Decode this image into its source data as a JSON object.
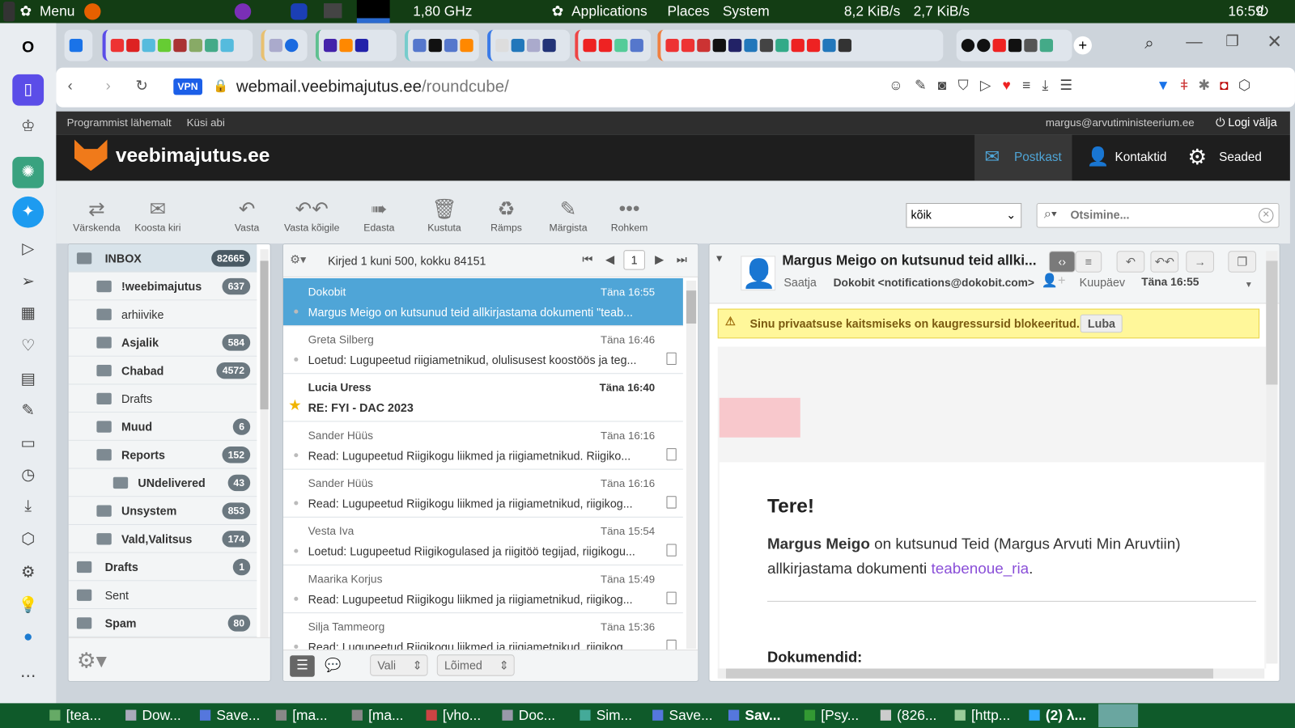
{
  "system_bar": {
    "menu": "Menu",
    "cpu": "1,80 GHz",
    "applications": "Applications",
    "places": "Places",
    "system": "System",
    "net": "8,2 KiB/s",
    "net_up": "2,7 KiB/s",
    "time": "16:59"
  },
  "browser": {
    "vpn": "VPN",
    "url_host": "webmail.veebimajutus.ee",
    "url_path": "/roundcube/"
  },
  "rc": {
    "top_links": [
      "Programmist lähemalt",
      "Küsi abi"
    ],
    "user": "margus@arvutiministeerium.ee",
    "logout": "Logi välja",
    "logo": "veebimajutus.ee",
    "nav": [
      "Postkast",
      "Kontaktid",
      "Seaded"
    ],
    "toolbar": [
      "Värskenda",
      "Koosta kiri",
      "Vasta",
      "Vasta kõigile",
      "Edasta",
      "Kustuta",
      "Rämps",
      "Märgista",
      "Rohkem"
    ],
    "filter": "kõik",
    "search_placeholder": "Otsimine...",
    "folders": [
      {
        "name": "INBOX",
        "count": "82665"
      },
      {
        "name": "!weebimajutus",
        "count": "637"
      },
      {
        "name": "arhiivike",
        "count": ""
      },
      {
        "name": "Asjalik",
        "count": "584"
      },
      {
        "name": "Chabad",
        "count": "4572"
      },
      {
        "name": "Drafts",
        "count": ""
      },
      {
        "name": "Muud",
        "count": "6"
      },
      {
        "name": "Reports",
        "count": "152"
      },
      {
        "name": "UNdelivered",
        "count": "43"
      },
      {
        "name": "Unsystem",
        "count": "853"
      },
      {
        "name": "Vald,Valitsus",
        "count": "174"
      },
      {
        "name": "Drafts",
        "count": "1"
      },
      {
        "name": "Sent",
        "count": ""
      },
      {
        "name": "Spam",
        "count": "80"
      }
    ],
    "list_info": "Kirjed 1 kuni 500, kokku 84151",
    "page": "1",
    "messages": [
      {
        "from": "Dokobit",
        "date": "Täna 16:55",
        "subject": "Margus Meigo on kutsunud teid allkirjastama dokumenti \"teab..."
      },
      {
        "from": "Greta Silberg",
        "date": "Täna 16:46",
        "subject": "Loetud: Lugupeetud riigiametnikud, olulisusest koostöös ja teg..."
      },
      {
        "from": "Lucia Uress",
        "date": "Täna 16:40",
        "subject": "RE: FYI - DAC 2023"
      },
      {
        "from": "Sander Hüüs",
        "date": "Täna 16:16",
        "subject": "Read: Lugupeetud Riigikogu liikmed ja riigiametnikud. Riigiko..."
      },
      {
        "from": "Sander Hüüs",
        "date": "Täna 16:16",
        "subject": "Read: Lugupeetud Riigikogu liikmed ja riigiametnikud, riigikog..."
      },
      {
        "from": "Vesta Iva",
        "date": "Täna 15:54",
        "subject": "Loetud: Lugupeetud Riigikogulased ja riigitöö tegijad, riigikogu..."
      },
      {
        "from": "Maarika Korjus",
        "date": "Täna 15:49",
        "subject": "Read: Lugupeetud Riigikogu liikmed ja riigiametnikud, riigikog..."
      },
      {
        "from": "Silja Tammeorg",
        "date": "Täna 15:36",
        "subject": "Read: Lugupeetud Riigikogu liikmed ja riigiametnikud, riigikog..."
      }
    ],
    "select_label": "Vali",
    "threads_label": "Lõimed",
    "preview": {
      "subject": "Margus Meigo on kutsunud teid allki...",
      "from_label": "Saatja",
      "from": "Dokobit <notifications@dokobit.com>",
      "date_label": "Kuupäev",
      "date": "Täna 16:55",
      "warning": "Sinu privaatsuse kaitsmiseks on kaugressursid blokeeritud.",
      "allow": "Luba",
      "greeting": "Tere!",
      "inviter": "Margus Meigo",
      "body1": " on kutsunud Teid (Margus Arvuti Min Aruvtiin)",
      "body2": "allkirjastama dokumenti ",
      "doc_link": "teabenoue_ria",
      "body_end": ".",
      "docs_heading": "Dokumendid:"
    }
  },
  "taskbar": [
    "[tea...",
    "Dow...",
    "Save...",
    "[ma...",
    "[ma...",
    "[vho...",
    "Doc...",
    "Sim...",
    "Save...",
    "Sav...",
    "[Psy...",
    "(826...",
    "[http...",
    "(2) λ..."
  ]
}
